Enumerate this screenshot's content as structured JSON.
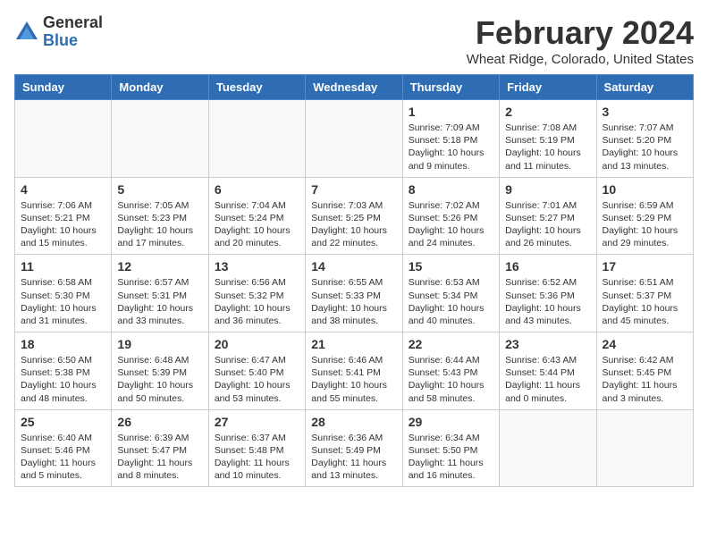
{
  "header": {
    "logo_line1": "General",
    "logo_line2": "Blue",
    "month_title": "February 2024",
    "location": "Wheat Ridge, Colorado, United States"
  },
  "weekdays": [
    "Sunday",
    "Monday",
    "Tuesday",
    "Wednesday",
    "Thursday",
    "Friday",
    "Saturday"
  ],
  "weeks": [
    [
      {
        "day": "",
        "info": ""
      },
      {
        "day": "",
        "info": ""
      },
      {
        "day": "",
        "info": ""
      },
      {
        "day": "",
        "info": ""
      },
      {
        "day": "1",
        "info": "Sunrise: 7:09 AM\nSunset: 5:18 PM\nDaylight: 10 hours\nand 9 minutes."
      },
      {
        "day": "2",
        "info": "Sunrise: 7:08 AM\nSunset: 5:19 PM\nDaylight: 10 hours\nand 11 minutes."
      },
      {
        "day": "3",
        "info": "Sunrise: 7:07 AM\nSunset: 5:20 PM\nDaylight: 10 hours\nand 13 minutes."
      }
    ],
    [
      {
        "day": "4",
        "info": "Sunrise: 7:06 AM\nSunset: 5:21 PM\nDaylight: 10 hours\nand 15 minutes."
      },
      {
        "day": "5",
        "info": "Sunrise: 7:05 AM\nSunset: 5:23 PM\nDaylight: 10 hours\nand 17 minutes."
      },
      {
        "day": "6",
        "info": "Sunrise: 7:04 AM\nSunset: 5:24 PM\nDaylight: 10 hours\nand 20 minutes."
      },
      {
        "day": "7",
        "info": "Sunrise: 7:03 AM\nSunset: 5:25 PM\nDaylight: 10 hours\nand 22 minutes."
      },
      {
        "day": "8",
        "info": "Sunrise: 7:02 AM\nSunset: 5:26 PM\nDaylight: 10 hours\nand 24 minutes."
      },
      {
        "day": "9",
        "info": "Sunrise: 7:01 AM\nSunset: 5:27 PM\nDaylight: 10 hours\nand 26 minutes."
      },
      {
        "day": "10",
        "info": "Sunrise: 6:59 AM\nSunset: 5:29 PM\nDaylight: 10 hours\nand 29 minutes."
      }
    ],
    [
      {
        "day": "11",
        "info": "Sunrise: 6:58 AM\nSunset: 5:30 PM\nDaylight: 10 hours\nand 31 minutes."
      },
      {
        "day": "12",
        "info": "Sunrise: 6:57 AM\nSunset: 5:31 PM\nDaylight: 10 hours\nand 33 minutes."
      },
      {
        "day": "13",
        "info": "Sunrise: 6:56 AM\nSunset: 5:32 PM\nDaylight: 10 hours\nand 36 minutes."
      },
      {
        "day": "14",
        "info": "Sunrise: 6:55 AM\nSunset: 5:33 PM\nDaylight: 10 hours\nand 38 minutes."
      },
      {
        "day": "15",
        "info": "Sunrise: 6:53 AM\nSunset: 5:34 PM\nDaylight: 10 hours\nand 40 minutes."
      },
      {
        "day": "16",
        "info": "Sunrise: 6:52 AM\nSunset: 5:36 PM\nDaylight: 10 hours\nand 43 minutes."
      },
      {
        "day": "17",
        "info": "Sunrise: 6:51 AM\nSunset: 5:37 PM\nDaylight: 10 hours\nand 45 minutes."
      }
    ],
    [
      {
        "day": "18",
        "info": "Sunrise: 6:50 AM\nSunset: 5:38 PM\nDaylight: 10 hours\nand 48 minutes."
      },
      {
        "day": "19",
        "info": "Sunrise: 6:48 AM\nSunset: 5:39 PM\nDaylight: 10 hours\nand 50 minutes."
      },
      {
        "day": "20",
        "info": "Sunrise: 6:47 AM\nSunset: 5:40 PM\nDaylight: 10 hours\nand 53 minutes."
      },
      {
        "day": "21",
        "info": "Sunrise: 6:46 AM\nSunset: 5:41 PM\nDaylight: 10 hours\nand 55 minutes."
      },
      {
        "day": "22",
        "info": "Sunrise: 6:44 AM\nSunset: 5:43 PM\nDaylight: 10 hours\nand 58 minutes."
      },
      {
        "day": "23",
        "info": "Sunrise: 6:43 AM\nSunset: 5:44 PM\nDaylight: 11 hours\nand 0 minutes."
      },
      {
        "day": "24",
        "info": "Sunrise: 6:42 AM\nSunset: 5:45 PM\nDaylight: 11 hours\nand 3 minutes."
      }
    ],
    [
      {
        "day": "25",
        "info": "Sunrise: 6:40 AM\nSunset: 5:46 PM\nDaylight: 11 hours\nand 5 minutes."
      },
      {
        "day": "26",
        "info": "Sunrise: 6:39 AM\nSunset: 5:47 PM\nDaylight: 11 hours\nand 8 minutes."
      },
      {
        "day": "27",
        "info": "Sunrise: 6:37 AM\nSunset: 5:48 PM\nDaylight: 11 hours\nand 10 minutes."
      },
      {
        "day": "28",
        "info": "Sunrise: 6:36 AM\nSunset: 5:49 PM\nDaylight: 11 hours\nand 13 minutes."
      },
      {
        "day": "29",
        "info": "Sunrise: 6:34 AM\nSunset: 5:50 PM\nDaylight: 11 hours\nand 16 minutes."
      },
      {
        "day": "",
        "info": ""
      },
      {
        "day": "",
        "info": ""
      }
    ]
  ]
}
